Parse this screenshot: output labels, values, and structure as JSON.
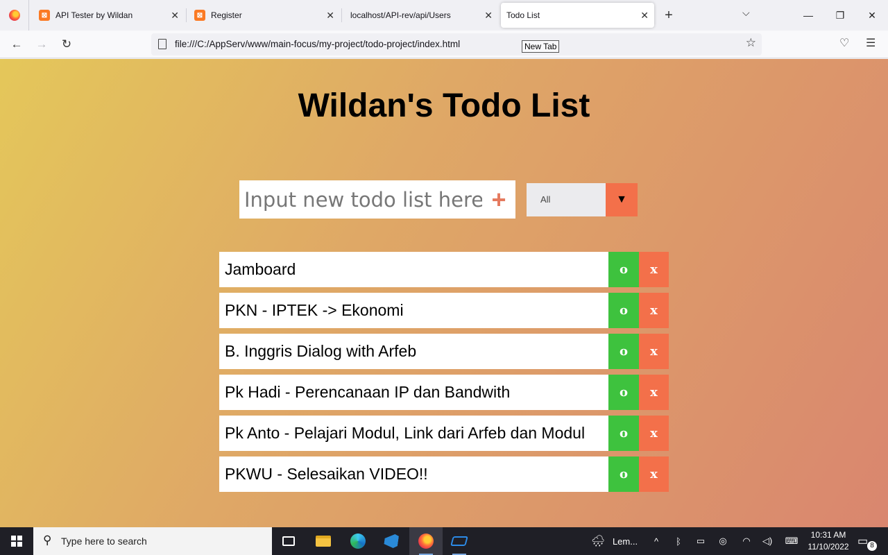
{
  "browser": {
    "tabs": [
      {
        "title": "API Tester by Wildan",
        "favicon": "xampp-icon"
      },
      {
        "title": "Register",
        "favicon": "xampp-icon"
      },
      {
        "title": "localhost/API-rev/api/Users",
        "favicon": ""
      },
      {
        "title": "Todo List",
        "favicon": "",
        "active": true
      }
    ],
    "url": "file:///C:/AppServ/www/main-focus/my-project/todo-project/index.html",
    "tooltip": "New Tab"
  },
  "app": {
    "title": "Wildan's Todo List",
    "input_placeholder": "Input new todo list here",
    "add_label": "+",
    "filter_selected": "All",
    "filter_arrow": "▼",
    "complete_label": "o",
    "delete_label": "x",
    "todos": [
      "Jamboard",
      "PKN - IPTEK -> Ekonomi",
      "B. Inggris Dialog with Arfeb",
      "Pk Hadi - Perencanaan IP dan Bandwith",
      "Pk Anto - Pelajari Modul, Link dari Arfeb dan Modul",
      "PKWU - Selesaikan VIDEO!!"
    ],
    "colors": {
      "complete": "#3ec23e",
      "delete": "#f3704a",
      "gradient_start": "#e4c75a",
      "gradient_end": "#d9866f"
    }
  },
  "taskbar": {
    "search_placeholder": "Type here to search",
    "weather_text": "Lem...",
    "time": "10:31 AM",
    "date": "11/10/2022",
    "notification_count": "8"
  }
}
